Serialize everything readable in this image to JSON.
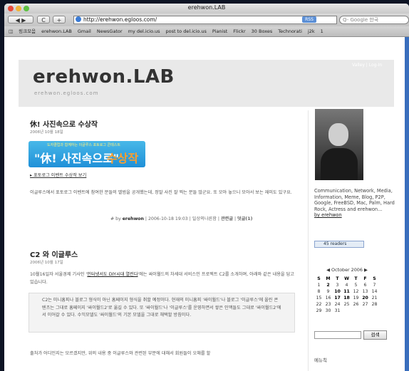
{
  "window": {
    "title": "erehwon.LAB"
  },
  "toolbar": {
    "back": "◀ ▶",
    "reload": "C",
    "add": "+",
    "url": "http://erehwon.egloos.com/",
    "rss": "RSS",
    "search_placeholder": "Q- Google 한국"
  },
  "bookmarks": [
    "◫",
    "링크모음",
    "erehwon.LAB",
    "Gmail",
    "NewsGator",
    "my del.icio.us",
    "post to del.icio.us",
    "Pianist",
    "Flickr",
    "30 Boxes",
    "Technorati",
    "j2k",
    "1"
  ],
  "header": {
    "title": "erehwon.LAB",
    "subtitle": "erehwon.egloos.com",
    "login": "Valley | Log-In"
  },
  "post1": {
    "title": "休! 사진속으로 수상작",
    "date": "2006년 10월 18일",
    "banner_top": "도자클럽과 함께하는 이글루스 포토로그 콘테스트",
    "banner_main": "\"休! 사진속으로\"",
    "banner_accent": "수상작",
    "link": "▸ 포토로그 이벤트 수상작 보기",
    "body": "이글루스에서 포토로그 이벤트에 참여한 분들의 앨범을 공개했는데, 정말 사진 잘 찍는 분들 많군요. 또 모아 놓으니 모아서 보는 재미도 있구요.",
    "meta_prefix": "# by",
    "meta_author": "erehwon",
    "meta_rest": "| 2006-10-18 19:03 | 일상의나른함 |",
    "meta_related": "관련글",
    "meta_sep": "|",
    "meta_comments": "덧글(1)"
  },
  "post2": {
    "title": "C2 와 이글루스",
    "date": "2006년 10월 17일",
    "body_start": "10월16일자 서울경제 기사인 '",
    "body_link": "인터넷서도 DIY시대 열린다",
    "body_end": "'에는 싸이월드의 차세대 서비스인 프로젝트 C2를 소개하며, 아래와 같은 내용을 담고 있습니다.",
    "quote": "C2는 미니홈피나 블로그 형식이 아닌 홈페이지 형식을 취할 예정이다. 현재의 미니홈피 '싸이월드'나 블로그 '이글루스'에 올린 콘텐츠는 그대로 홈페이지 '싸이월드2'로 옮길 수 있다. 또 '싸이월드'나 '이글루스'를 운영하면서 쌓은 인맥들도 그대로 '싸이월드2'에서 이어갈 수 있다. 수익모델도 '싸이월드'의 기본 모델을 그대로 채택할 방침이다.",
    "footer": "출처가 어디인지는 모르겠지만, 위의 내용 중 이글루스와 관련된 부분에 대해서 회원들이 오해를 할"
  },
  "sidebar": {
    "profile": "Communication, Network, Media, Information, Meme, Blog, P2P, Google, FreeBSD, Mac, Palm, Hard Rock, Actress and erehwon...",
    "profile_by": "by erehwon",
    "widget": "45 readers",
    "calendar": {
      "title": "◀ October 2006 ▶",
      "headers": [
        "S",
        "M",
        "T",
        "W",
        "T",
        "F",
        "S"
      ],
      "rows": [
        [
          "1",
          "2",
          "3",
          "4",
          "5",
          "6",
          "7"
        ],
        [
          "8",
          "9",
          "10",
          "11",
          "12",
          "13",
          "14"
        ],
        [
          "15",
          "16",
          "17",
          "18",
          "19",
          "20",
          "21"
        ],
        [
          "22",
          "23",
          "24",
          "25",
          "26",
          "27",
          "28"
        ],
        [
          "29",
          "30",
          "31",
          "",
          "",
          "",
          ""
        ]
      ],
      "bold_days": [
        "2",
        "10",
        "11",
        "17",
        "18",
        "20"
      ]
    },
    "search_button": "검색",
    "label": "메뉴칙"
  }
}
